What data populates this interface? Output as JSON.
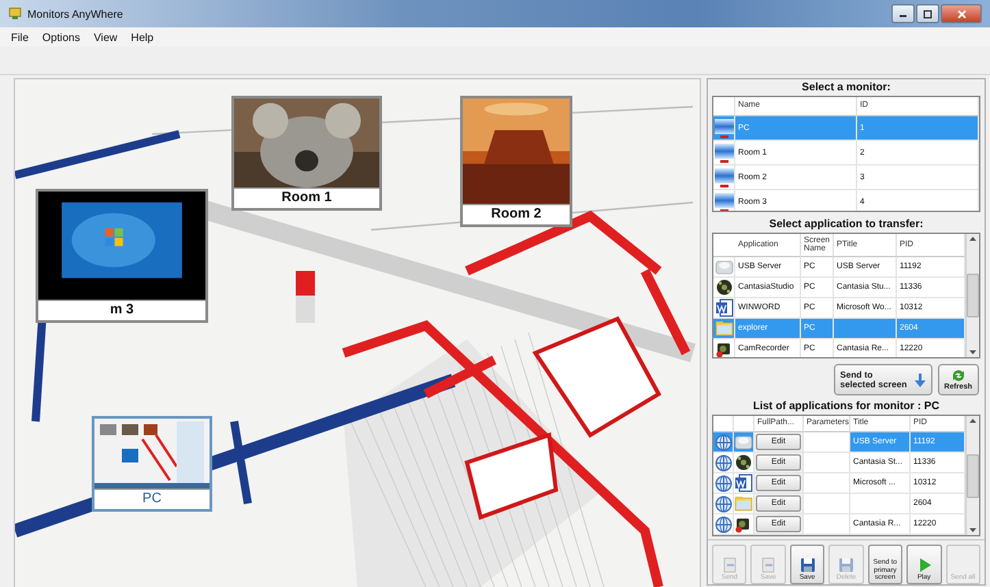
{
  "window": {
    "title": "Monitors AnyWhere"
  },
  "menu": [
    "File",
    "Options",
    "View",
    "Help"
  ],
  "map": {
    "tiles": [
      {
        "label": "Room 1",
        "kind": "animal"
      },
      {
        "label": "Room 2",
        "kind": "desert"
      },
      {
        "label": "m 3",
        "kind": "desktop"
      },
      {
        "label": "PC",
        "kind": "screen"
      }
    ]
  },
  "monitors": {
    "title": "Select a monitor:",
    "columns": [
      "Name",
      "ID"
    ],
    "rows": [
      {
        "name": "PC",
        "id": "1",
        "selected": true
      },
      {
        "name": "Room 1",
        "id": "2",
        "selected": false
      },
      {
        "name": "Room 2",
        "id": "3",
        "selected": false
      },
      {
        "name": "Room 3",
        "id": "4",
        "selected": false
      }
    ]
  },
  "applications": {
    "title": "Select application to transfer:",
    "columns": [
      "Application",
      "Screen Name",
      "PTitle",
      "PID"
    ],
    "rows": [
      {
        "kind": "cloud",
        "application": "USB Server",
        "screen": "PC",
        "ptitle": "USB Server",
        "pid": "11192",
        "selected": false
      },
      {
        "kind": "reel",
        "application": "CantasiaStudio",
        "screen": "PC",
        "ptitle": "Cantasia Stu...",
        "pid": "11336",
        "selected": false
      },
      {
        "kind": "word",
        "application": "WINWORD",
        "screen": "PC",
        "ptitle": "Microsoft Wo...",
        "pid": "10312",
        "selected": false
      },
      {
        "kind": "folder",
        "application": "explorer",
        "screen": "PC",
        "pid": "2604",
        "selected": true
      },
      {
        "kind": "recorder",
        "application": "CamRecorder",
        "screen": "PC",
        "ptitle": "Cantasia Re...",
        "pid": "12220",
        "selected": false
      }
    ]
  },
  "send_button": "Send to selected screen",
  "refresh_button": "Refresh",
  "monitor_apps": {
    "title": "List of applications for monitor : PC",
    "columns": [
      "FullPath...",
      "Parameters",
      "Title",
      "PID"
    ],
    "rows": [
      {
        "kind": "cloud",
        "button": "Edit",
        "title": "USB Server",
        "pid": "11192",
        "selected": true
      },
      {
        "kind": "reel",
        "button": "Edit",
        "title": "Cantasia St...",
        "pid": "11336",
        "selected": false
      },
      {
        "kind": "word",
        "button": "Edit",
        "title": "Microsoft ...",
        "pid": "10312",
        "selected": false
      },
      {
        "kind": "folder",
        "button": "Edit",
        "pid": "2604",
        "selected": false
      },
      {
        "kind": "recorder",
        "button": "Edit",
        "title": "Cantasia R...",
        "pid": "12220",
        "selected": false
      }
    ]
  },
  "actions": [
    {
      "label": "Send",
      "kind": "send",
      "disabled": true
    },
    {
      "label": "Save",
      "kind": "send",
      "disabled": true
    },
    {
      "label": "Save",
      "kind": "disk",
      "disabled": false
    },
    {
      "label": "Delete",
      "kind": "disk",
      "disabled": true
    },
    {
      "label": "Send to primary screen",
      "kind": "text",
      "disabled": false
    },
    {
      "label": "Play",
      "kind": "play",
      "disabled": false
    },
    {
      "label": "Send all",
      "kind": "text",
      "disabled": true
    }
  ]
}
